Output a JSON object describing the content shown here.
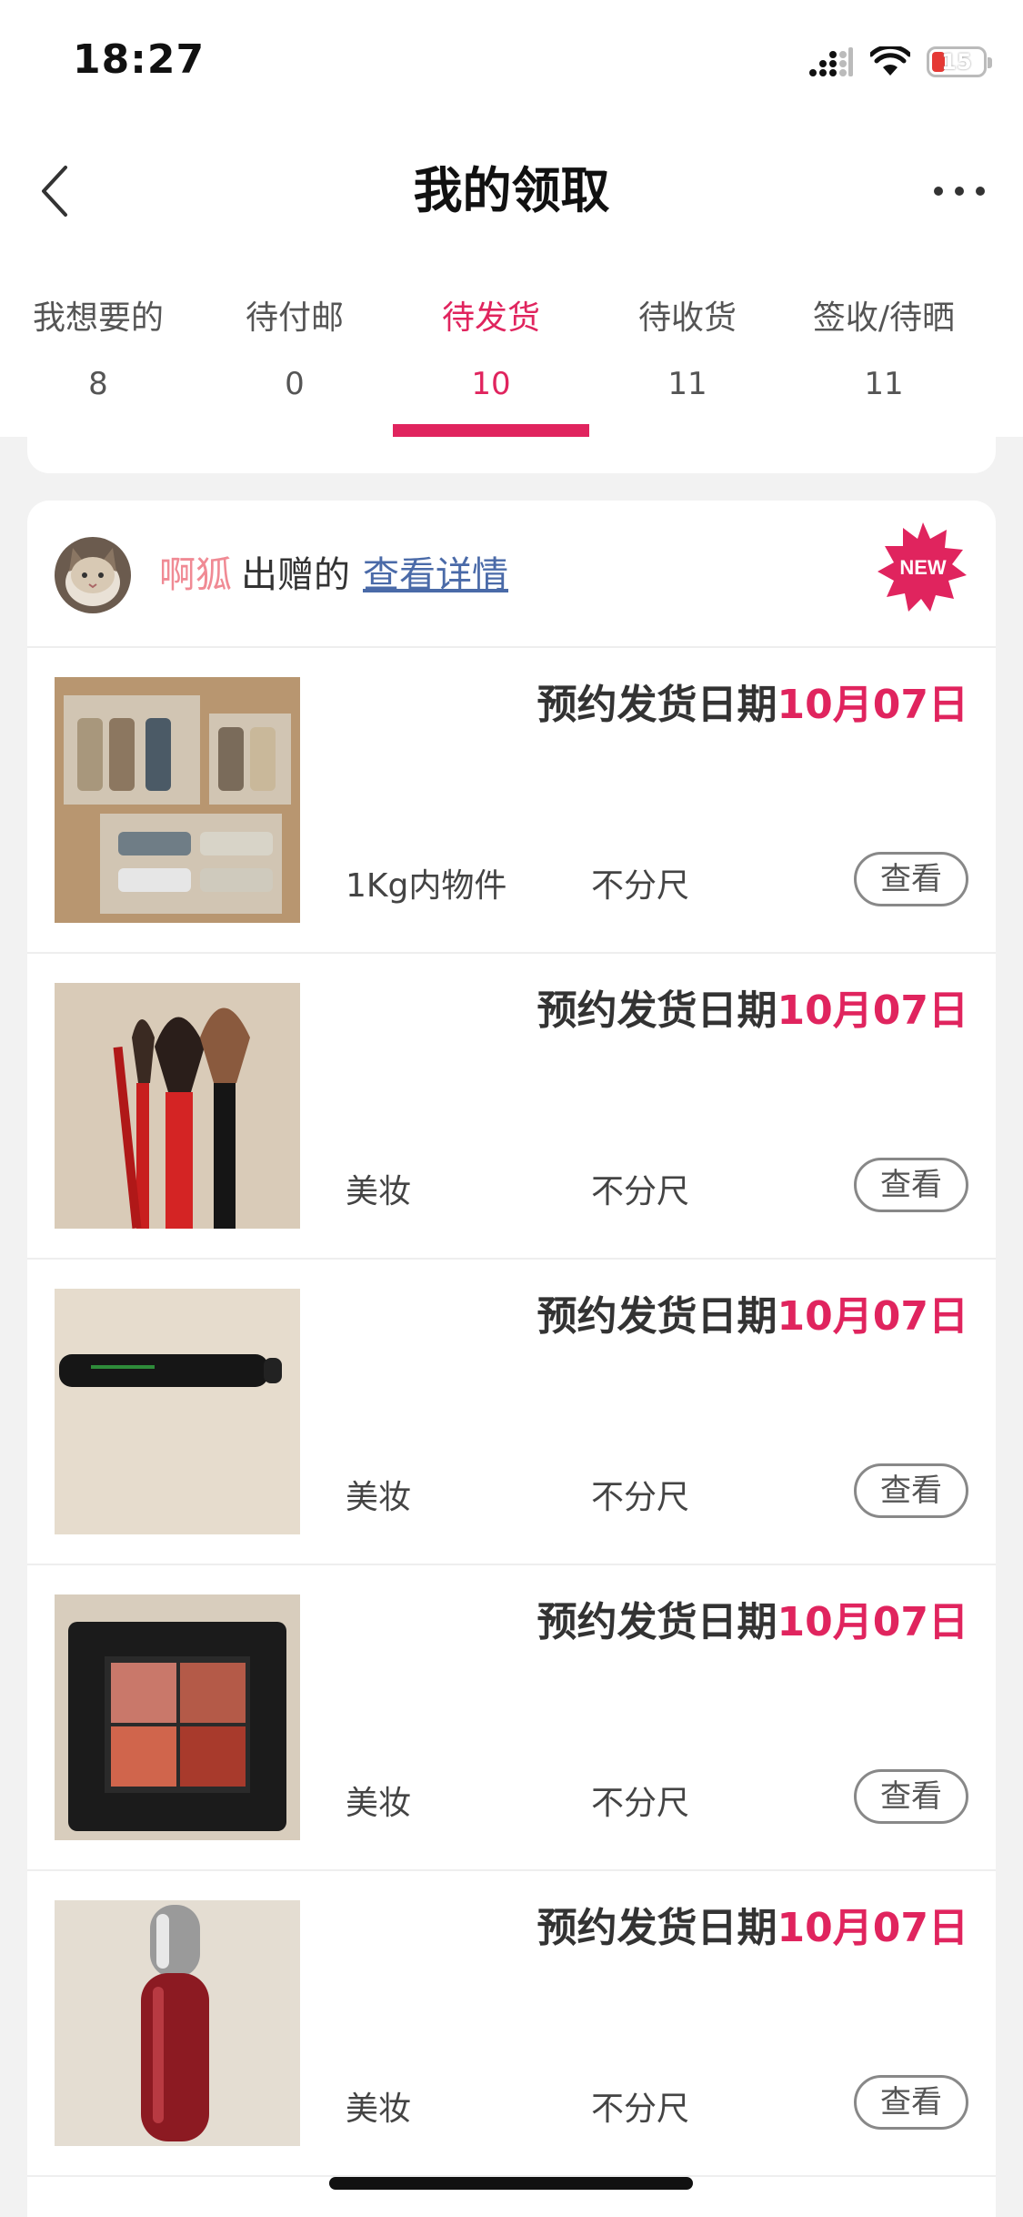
{
  "status_bar": {
    "time": "18:27",
    "battery": "15",
    "battery_color": "#e53935"
  },
  "nav": {
    "title": "我的领取",
    "back_icon": "chevron-left-icon",
    "more_icon": "more-dots-icon"
  },
  "tabs": [
    {
      "label": "我想要的",
      "count": "8",
      "active": false
    },
    {
      "label": "待付邮",
      "count": "0",
      "active": false
    },
    {
      "label": "待发货",
      "count": "10",
      "active": true
    },
    {
      "label": "待收货",
      "count": "11",
      "active": false
    },
    {
      "label": "签收/待晒",
      "count": "11",
      "active": false
    }
  ],
  "accent_color": "#e0245e",
  "card": {
    "giver_name": "啊狐",
    "gave_text": "出赠的",
    "detail_link": "查看详情",
    "badge": "NEW",
    "items": [
      {
        "thumb": "sewing-threads-photo",
        "ship_label": "预约发货日期",
        "ship_date": "10月07日",
        "category": "1Kg内物件",
        "size": "不分尺",
        "view_label": "查看"
      },
      {
        "thumb": "makeup-brushes-photo",
        "ship_label": "预约发货日期",
        "ship_date": "10月07日",
        "category": "美妆",
        "size": "不分尺",
        "view_label": "查看"
      },
      {
        "thumb": "mascara-photo",
        "ship_label": "预约发货日期",
        "ship_date": "10月07日",
        "category": "美妆",
        "size": "不分尺",
        "view_label": "查看"
      },
      {
        "thumb": "eyeshadow-palette-photo",
        "ship_label": "预约发货日期",
        "ship_date": "10月07日",
        "category": "美妆",
        "size": "不分尺",
        "view_label": "查看"
      },
      {
        "thumb": "lip-gloss-photo",
        "ship_label": "预约发货日期",
        "ship_date": "10月07日",
        "category": "美妆",
        "size": "不分尺",
        "view_label": "查看"
      }
    ]
  }
}
